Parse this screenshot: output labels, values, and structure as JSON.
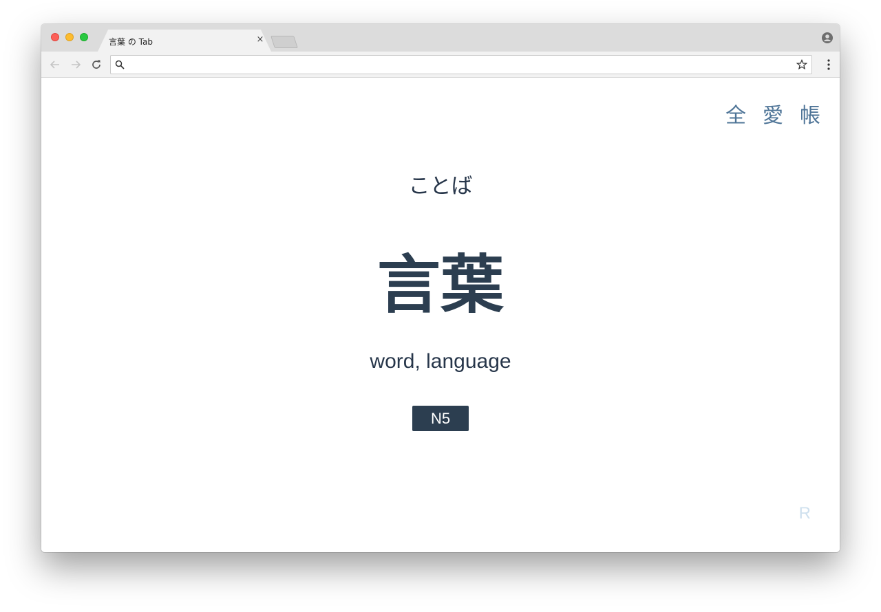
{
  "browser": {
    "tab_title": "言葉 の Tab",
    "tab_close_glyph": "×",
    "address_value": "",
    "icons": {
      "back": "back-arrow-icon",
      "forward": "forward-arrow-icon",
      "reload": "reload-icon",
      "search": "search-icon",
      "star": "star-icon",
      "menu": "kebab-menu-icon",
      "profile": "profile-icon"
    },
    "colors": {
      "close": "#fc5f57",
      "minimize": "#fdbc2e",
      "maximize": "#28c840"
    }
  },
  "page": {
    "nav": [
      "全",
      "愛",
      "帳"
    ],
    "reading": "ことば",
    "word": "言葉",
    "meaning": "word, language",
    "level": "N5",
    "random_label": "R",
    "colors": {
      "text": "#2c3e50",
      "nav": "#4e7497",
      "badge_bg": "#2c3e50",
      "faint": "#cfe0ee"
    }
  }
}
